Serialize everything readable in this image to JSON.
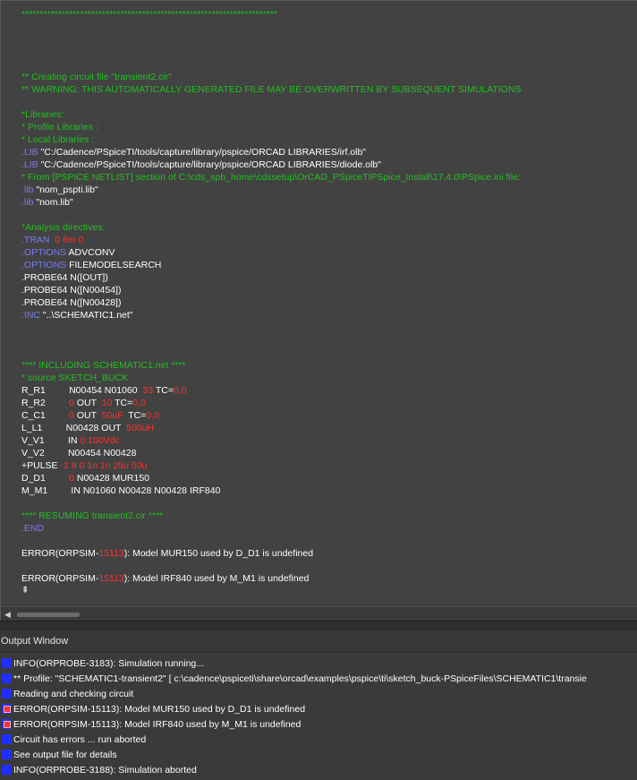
{
  "editor": {
    "lines": [
      [
        {
          "t": "**********************************************************************",
          "c": "green"
        }
      ],
      [],
      [],
      [],
      [],
      [
        {
          "t": "** Creating circuit file \"transient2.cir\"",
          "c": "green"
        }
      ],
      [
        {
          "t": "** WARNING: THIS AUTOMATICALLY GENERATED FILE MAY BE OVERWRITTEN BY SUBSEQUENT SIMULATIONS",
          "c": "green"
        }
      ],
      [],
      [
        {
          "t": "*Libraries:",
          "c": "green"
        }
      ],
      [
        {
          "t": "* Profile Libraries :",
          "c": "green"
        }
      ],
      [
        {
          "t": "* Local Libraries :",
          "c": "green"
        }
      ],
      [
        {
          "t": ".LIB",
          "c": "blue"
        },
        {
          "t": " \"C:/Cadence/PSpiceTI/tools/capture/library/pspice/ORCAD LIBRARIES/irf.olb\"",
          "c": "white"
        }
      ],
      [
        {
          "t": ".LIB",
          "c": "blue"
        },
        {
          "t": " \"C:/Cadence/PSpiceTI/tools/capture/library/pspice/ORCAD LIBRARIES/diode.olb\"",
          "c": "white"
        }
      ],
      [
        {
          "t": "* From [PSPICE NETLIST] section of C:\\cds_spb_home\\cdssetup\\OrCAD_PSpiceTIPSpice_Install\\17.4.0\\PSpice.ini file:",
          "c": "green"
        }
      ],
      [
        {
          "t": ".lib",
          "c": "blue"
        },
        {
          "t": " \"nom_pspti.lib\"",
          "c": "white"
        }
      ],
      [
        {
          "t": ".lib",
          "c": "blue"
        },
        {
          "t": " \"nom.lib\"",
          "c": "white"
        }
      ],
      [],
      [
        {
          "t": "*Analysis directives:",
          "c": "green"
        }
      ],
      [
        {
          "t": ".TRAN",
          "c": "blue"
        },
        {
          "t": "  0 6m 0",
          "c": "red"
        }
      ],
      [
        {
          "t": ".OPTIONS",
          "c": "blue"
        },
        {
          "t": " ADVCONV",
          "c": "white"
        }
      ],
      [
        {
          "t": ".OPTIONS",
          "c": "blue"
        },
        {
          "t": " FILEMODELSEARCH",
          "c": "white"
        }
      ],
      [
        {
          "t": ".PROBE64 N([OUT])",
          "c": "white"
        }
      ],
      [
        {
          "t": ".PROBE64 N([N00454])",
          "c": "white"
        }
      ],
      [
        {
          "t": ".PROBE64 N([N00428])",
          "c": "white"
        }
      ],
      [
        {
          "t": ".INC",
          "c": "blue"
        },
        {
          "t": " \"..\\SCHEMATIC1.net\"",
          "c": "white"
        }
      ],
      [],
      [],
      [],
      [
        {
          "t": "**** INCLUDING SCHEMATIC1.net ****",
          "c": "green"
        }
      ],
      [
        {
          "t": "* source SKETCH_BUCK",
          "c": "green"
        }
      ],
      [
        {
          "t": "R_R1         N00454 N01060  ",
          "c": "white"
        },
        {
          "t": "33",
          "c": "red"
        },
        {
          "t": " TC=",
          "c": "white"
        },
        {
          "t": "0,0",
          "c": "red"
        }
      ],
      [
        {
          "t": "R_R2         ",
          "c": "white"
        },
        {
          "t": "0",
          "c": "red"
        },
        {
          "t": " OUT  ",
          "c": "white"
        },
        {
          "t": "10",
          "c": "red"
        },
        {
          "t": " TC=",
          "c": "white"
        },
        {
          "t": "0,0",
          "c": "red"
        }
      ],
      [
        {
          "t": "C_C1         ",
          "c": "white"
        },
        {
          "t": "0",
          "c": "red"
        },
        {
          "t": " OUT  ",
          "c": "white"
        },
        {
          "t": "50uF",
          "c": "red"
        },
        {
          "t": "  TC=",
          "c": "white"
        },
        {
          "t": "0,0",
          "c": "red"
        }
      ],
      [
        {
          "t": "L_L1         N00428 OUT  ",
          "c": "white"
        },
        {
          "t": "500uH",
          "c": "red"
        }
      ],
      [
        {
          "t": "V_V1         IN ",
          "c": "white"
        },
        {
          "t": "0 100Vdc",
          "c": "red"
        }
      ],
      [
        {
          "t": "V_V2         N00454 N00428",
          "c": "white"
        }
      ],
      [
        {
          "t": "+PULSE ",
          "c": "white"
        },
        {
          "t": "-1 8 0 1n 1n 25u 50u",
          "c": "red"
        }
      ],
      [
        {
          "t": "D_D1         ",
          "c": "white"
        },
        {
          "t": "0",
          "c": "red"
        },
        {
          "t": " N00428 MUR150",
          "c": "white"
        }
      ],
      [
        {
          "t": "M_M1         IN N01060 N00428 N00428 IRF840",
          "c": "white"
        }
      ],
      [],
      [
        {
          "t": "**** RESUMING transient2.cir ****",
          "c": "green"
        }
      ],
      [
        {
          "t": ".END",
          "c": "blue"
        }
      ],
      [],
      [
        {
          "t": "ERROR(ORPSIM-",
          "c": "white"
        },
        {
          "t": "15113",
          "c": "red"
        },
        {
          "t": "): Model MUR150 used by D_D1 is undefined",
          "c": "white"
        }
      ],
      [],
      [
        {
          "t": "ERROR(ORPSIM-",
          "c": "white"
        },
        {
          "t": "15113",
          "c": "red"
        },
        {
          "t": "): Model IRF840 used by M_M1 is undefined",
          "c": "white"
        }
      ]
    ],
    "cursor_glyph": "⇞",
    "scroll_left_glyph": "◀"
  },
  "output_window": {
    "title": "Output Window",
    "messages": [
      {
        "kind": "info",
        "text": "INFO(ORPROBE-3183): Simulation running..."
      },
      {
        "kind": "info",
        "text": "** Profile: \"SCHEMATIC1-transient2\"  [ c:\\cadence\\pspiceti\\share\\orcad\\examples\\pspice\\ti\\sketch_buck-PSpiceFiles\\SCHEMATIC1\\transie"
      },
      {
        "kind": "info",
        "text": "Reading and checking circuit"
      },
      {
        "kind": "error",
        "text": "ERROR(ORPSIM-15113): Model MUR150 used by D_D1 is undefined"
      },
      {
        "kind": "error",
        "text": "ERROR(ORPSIM-15113): Model IRF840 used by M_M1 is undefined"
      },
      {
        "kind": "info",
        "text": "Circuit has errors ... run aborted"
      },
      {
        "kind": "info",
        "text": "See output file for details"
      },
      {
        "kind": "info",
        "text": "INFO(ORPROBE-3188): Simulation aborted"
      }
    ]
  },
  "colors": {
    "comment": "#20c020",
    "keyword": "#7b7bf0",
    "value": "#ff3030",
    "text": "#ffffff",
    "info_icon": "#1f2fff",
    "error_icon": "#ff3030"
  }
}
